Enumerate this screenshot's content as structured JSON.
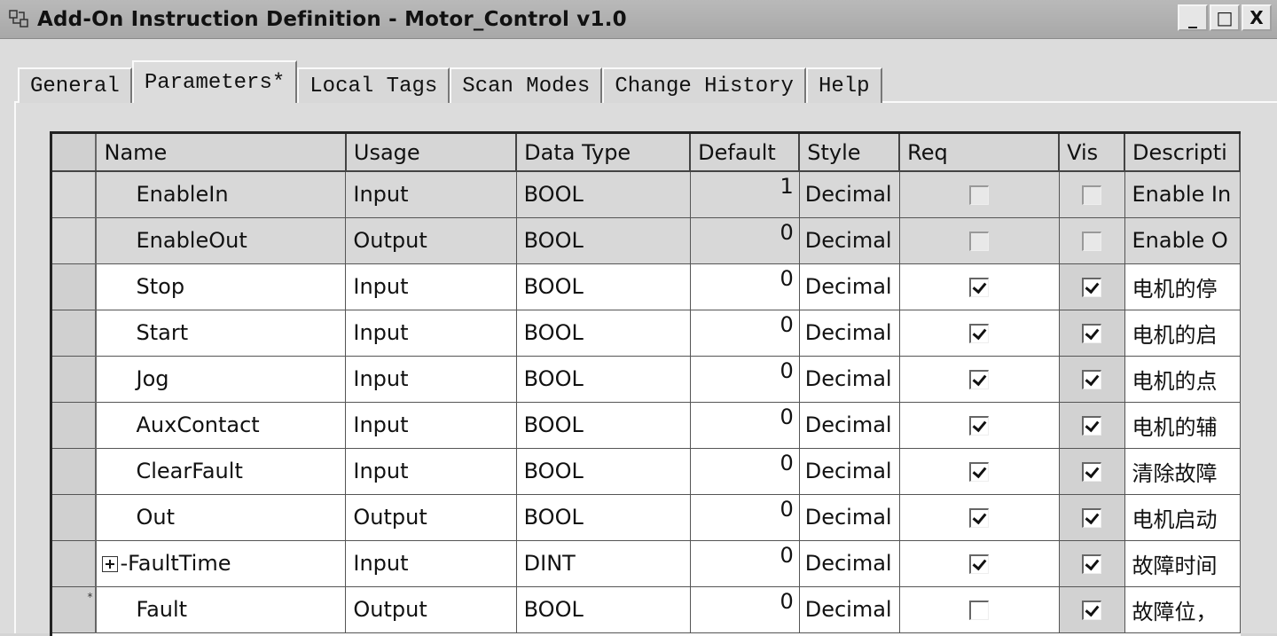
{
  "window": {
    "title": "Add-On Instruction Definition - Motor_Control v1.0",
    "icon": "aoi-instruction-icon",
    "buttons": {
      "minimize": "_",
      "maximize": "□",
      "close": "X"
    }
  },
  "tabs": [
    {
      "label": "General",
      "active": false
    },
    {
      "label": "Parameters*",
      "active": true
    },
    {
      "label": "Local Tags",
      "active": false
    },
    {
      "label": "Scan Modes",
      "active": false
    },
    {
      "label": "Change History",
      "active": false
    },
    {
      "label": "Help",
      "active": false
    }
  ],
  "grid": {
    "columns": [
      "Name",
      "Usage",
      "Data Type",
      "Default",
      "Style",
      "Req",
      "Vis",
      "Descripti"
    ],
    "rows": [
      {
        "name": "EnableIn",
        "usage": "Input",
        "type": "BOOL",
        "default": "1",
        "style": "Decimal",
        "req": false,
        "vis": false,
        "desc": "Enable In",
        "system": true,
        "expandable": false,
        "new_row": false
      },
      {
        "name": "EnableOut",
        "usage": "Output",
        "type": "BOOL",
        "default": "0",
        "style": "Decimal",
        "req": false,
        "vis": false,
        "desc": "Enable O",
        "system": true,
        "expandable": false,
        "new_row": false
      },
      {
        "name": "Stop",
        "usage": "Input",
        "type": "BOOL",
        "default": "0",
        "style": "Decimal",
        "req": true,
        "vis": true,
        "desc": "电机的停",
        "system": false,
        "expandable": false,
        "new_row": false
      },
      {
        "name": "Start",
        "usage": "Input",
        "type": "BOOL",
        "default": "0",
        "style": "Decimal",
        "req": true,
        "vis": true,
        "desc": "电机的启",
        "system": false,
        "expandable": false,
        "new_row": false
      },
      {
        "name": "Jog",
        "usage": "Input",
        "type": "BOOL",
        "default": "0",
        "style": "Decimal",
        "req": true,
        "vis": true,
        "desc": "电机的点",
        "system": false,
        "expandable": false,
        "new_row": false
      },
      {
        "name": "AuxContact",
        "usage": "Input",
        "type": "BOOL",
        "default": "0",
        "style": "Decimal",
        "req": true,
        "vis": true,
        "desc": "电机的辅",
        "system": false,
        "expandable": false,
        "new_row": false
      },
      {
        "name": "ClearFault",
        "usage": "Input",
        "type": "BOOL",
        "default": "0",
        "style": "Decimal",
        "req": true,
        "vis": true,
        "desc": "清除故障",
        "system": false,
        "expandable": false,
        "new_row": false
      },
      {
        "name": "Out",
        "usage": "Output",
        "type": "BOOL",
        "default": "0",
        "style": "Decimal",
        "req": true,
        "vis": true,
        "desc": "电机启动",
        "system": false,
        "expandable": false,
        "new_row": false
      },
      {
        "name": "-FaultTime",
        "usage": "Input",
        "type": "DINT",
        "default": "0",
        "style": "Decimal",
        "req": true,
        "vis": true,
        "desc": "故障时间",
        "system": false,
        "expandable": true,
        "new_row": false
      },
      {
        "name": "Fault",
        "usage": "Output",
        "type": "BOOL",
        "default": "0",
        "style": "Decimal",
        "req": false,
        "vis": true,
        "desc": "故障位，",
        "system": false,
        "expandable": false,
        "new_row": true
      }
    ]
  }
}
